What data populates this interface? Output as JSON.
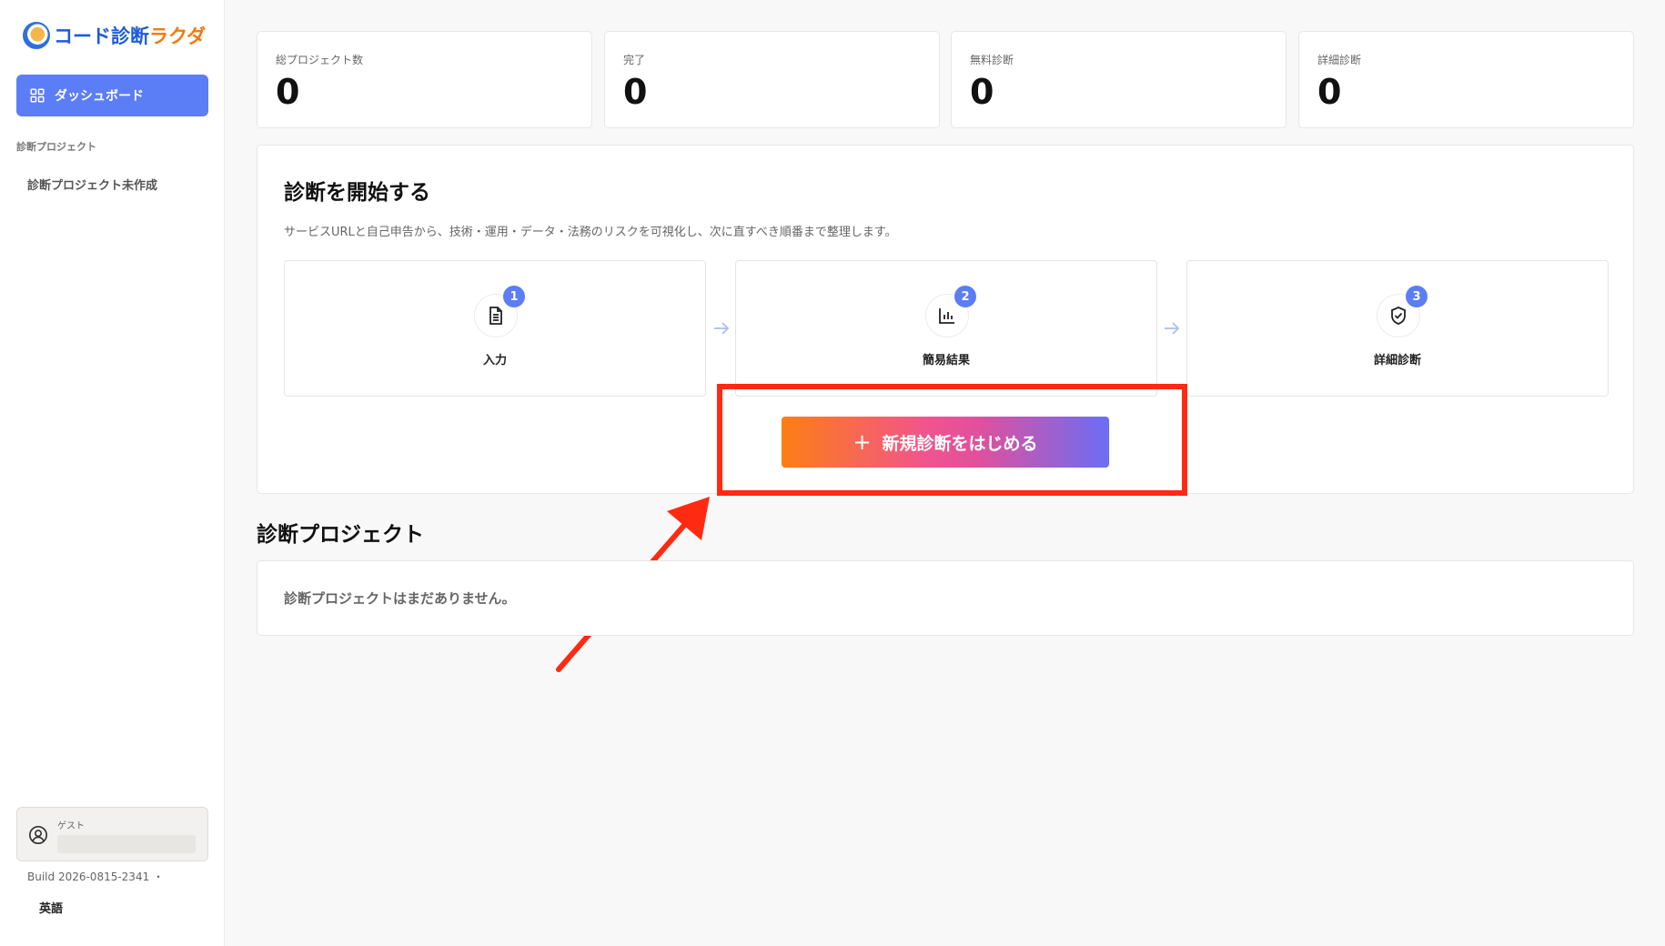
{
  "sidebar": {
    "logo": {
      "text_main": "コード診断",
      "text_accent": "ラクダ"
    },
    "nav": {
      "dashboard_label": "ダッシュボード"
    },
    "section_label": "診断プロジェクト",
    "project_empty": "診断プロジェクト未作成",
    "user": {
      "label": "ゲスト"
    },
    "build": "Build 2026-0815-2341 ・",
    "language": "英語"
  },
  "stats": [
    {
      "label": "総プロジェクト数",
      "value": "0"
    },
    {
      "label": "完了",
      "value": "0"
    },
    {
      "label": "無料診断",
      "value": "0"
    },
    {
      "label": "詳細診断",
      "value": "0"
    }
  ],
  "start_panel": {
    "title": "診断を開始する",
    "description": "サービスURLと自己申告から、技術・運用・データ・法務のリスクを可視化し、次に直すべき順番まで整理します。",
    "steps": [
      {
        "number": "1",
        "label": "入力",
        "icon": "document-icon"
      },
      {
        "number": "2",
        "label": "簡易結果",
        "icon": "bar-chart-icon"
      },
      {
        "number": "3",
        "label": "詳細診断",
        "icon": "shield-check-icon"
      }
    ],
    "cta": {
      "plus": "+",
      "label": "新規診断をはじめる"
    }
  },
  "projects": {
    "title": "診断プロジェクト",
    "empty_message": "診断プロジェクトはまだありません。"
  },
  "colors": {
    "accent": "#5b7df5",
    "highlight": "#ff2a12",
    "cta_gradient": [
      "#fd7e14",
      "#f0548f",
      "#6a6ef5"
    ]
  }
}
